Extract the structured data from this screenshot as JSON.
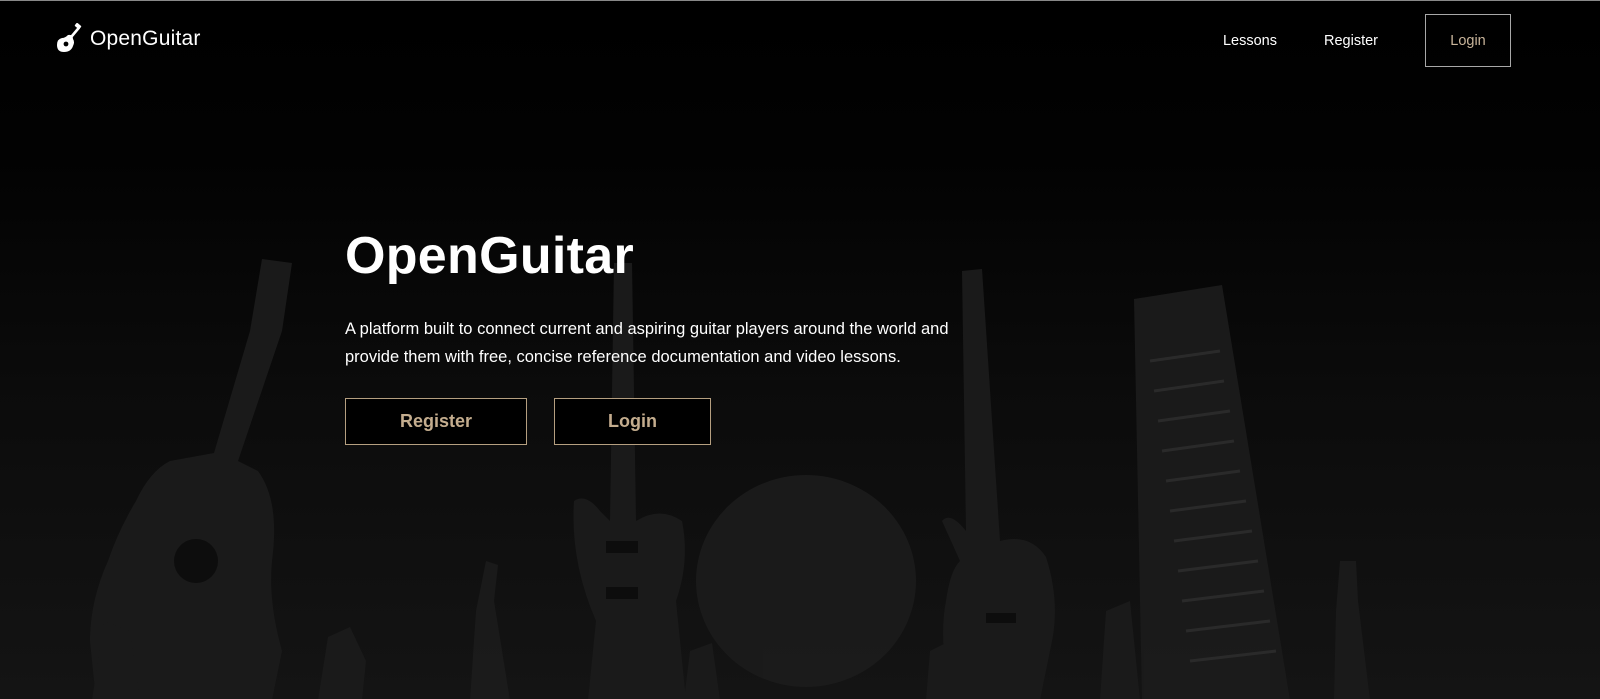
{
  "brand": {
    "name": "OpenGuitar",
    "icon": "guitar-icon"
  },
  "nav": {
    "lessons_label": "Lessons",
    "register_label": "Register",
    "login_label": "Login"
  },
  "hero": {
    "title": "OpenGuitar",
    "description": "A platform built to connect current and aspiring guitar players around the world and provide them with free, concise reference documentation and video lessons.",
    "register_label": "Register",
    "login_label": "Login"
  },
  "colors": {
    "background": "#000000",
    "accent_text": "#c4ad8e",
    "accent_border": "#b59f80",
    "text": "#ffffff"
  }
}
